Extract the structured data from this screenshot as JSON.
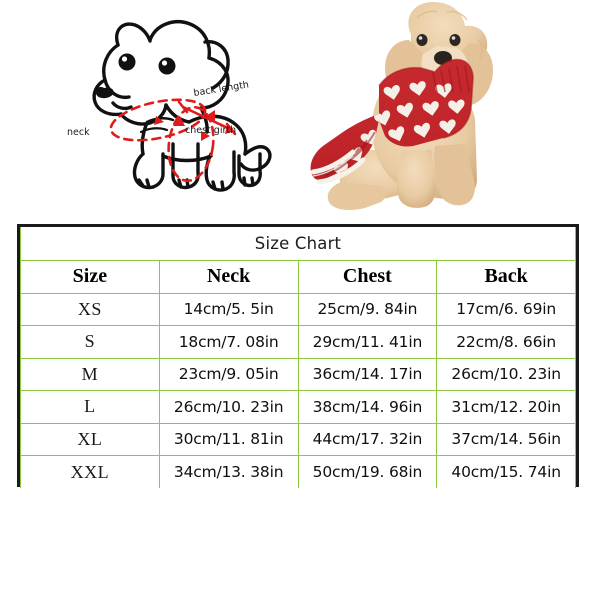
{
  "diagram": {
    "labels": {
      "back_length": "back length",
      "neck": "neck",
      "chest_girth": "chest girth"
    },
    "colors": {
      "outline": "#111111",
      "measure_line": "#E01B1B"
    }
  },
  "photo": {
    "alt": "apricot poodle wearing red heart-pattern sweater dress",
    "colors": {
      "sweater": "#C0262B",
      "sweater_shadow": "#9E1B20",
      "hearts": "#F4EFE6",
      "fur": "#EBCFA6",
      "fur_shadow": "#D9B383",
      "background": "#FFFFFF"
    }
  },
  "size_chart": {
    "title": "Size Chart",
    "columns": [
      "Size",
      "Neck",
      "Chest",
      "Back"
    ],
    "rows": [
      {
        "size": "XS",
        "neck": "14cm/5. 5in",
        "chest": "25cm/9. 84in",
        "back": "17cm/6. 69in"
      },
      {
        "size": "S",
        "neck": "18cm/7. 08in",
        "chest": "29cm/11. 41in",
        "back": "22cm/8. 66in"
      },
      {
        "size": "M",
        "neck": "23cm/9. 05in",
        "chest": "36cm/14. 17in",
        "back": "26cm/10. 23in"
      },
      {
        "size": "L",
        "neck": "26cm/10. 23in",
        "chest": "38cm/14. 96in",
        "back": "31cm/12. 20in"
      },
      {
        "size": "XL",
        "neck": "30cm/11. 81in",
        "chest": "44cm/17. 32in",
        "back": "37cm/14. 56in"
      },
      {
        "size": "XXL",
        "neck": "34cm/13. 38in",
        "chest": "50cm/19. 68in",
        "back": "40cm/15. 74in"
      }
    ],
    "colors": {
      "outer_border": "#1A1A1A",
      "grid_line": "#8DC63F",
      "background": "#FFFFFF"
    }
  }
}
